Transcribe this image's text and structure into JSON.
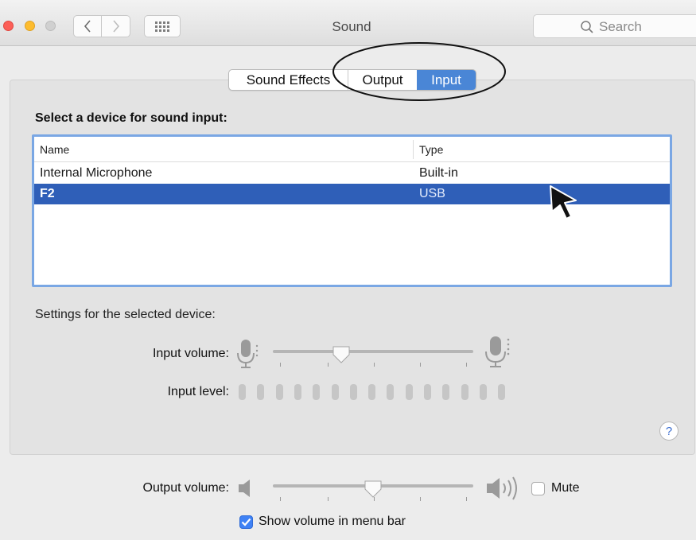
{
  "window": {
    "title": "Sound"
  },
  "toolbar": {
    "search_placeholder": "Search"
  },
  "tabs": [
    {
      "label": "Sound Effects",
      "selected": false
    },
    {
      "label": "Output",
      "selected": false
    },
    {
      "label": "Input",
      "selected": true
    }
  ],
  "input_pane": {
    "heading": "Select a device for sound input:",
    "columns": [
      "Name",
      "Type"
    ],
    "devices": [
      {
        "name": "Internal Microphone",
        "type": "Built-in",
        "selected": false
      },
      {
        "name": "F2",
        "type": "USB",
        "selected": true
      }
    ],
    "settings_heading": "Settings for the selected device:",
    "input_volume_label": "Input volume:",
    "input_volume_fraction": 0.34,
    "input_level_label": "Input level:",
    "input_level_bar_count": 15,
    "input_level_active": 0
  },
  "output": {
    "volume_label": "Output volume:",
    "volume_fraction": 0.5,
    "mute_label": "Mute",
    "mute_checked": false,
    "show_volume_label": "Show volume in menu bar",
    "show_volume_checked": true
  },
  "help_label": "?",
  "colors": {
    "accent": "#4a86d6",
    "selection": "#2f5fb8",
    "checkbox": "#3f82f5",
    "close": "#fc5f57",
    "minimize": "#fdbc2e"
  }
}
